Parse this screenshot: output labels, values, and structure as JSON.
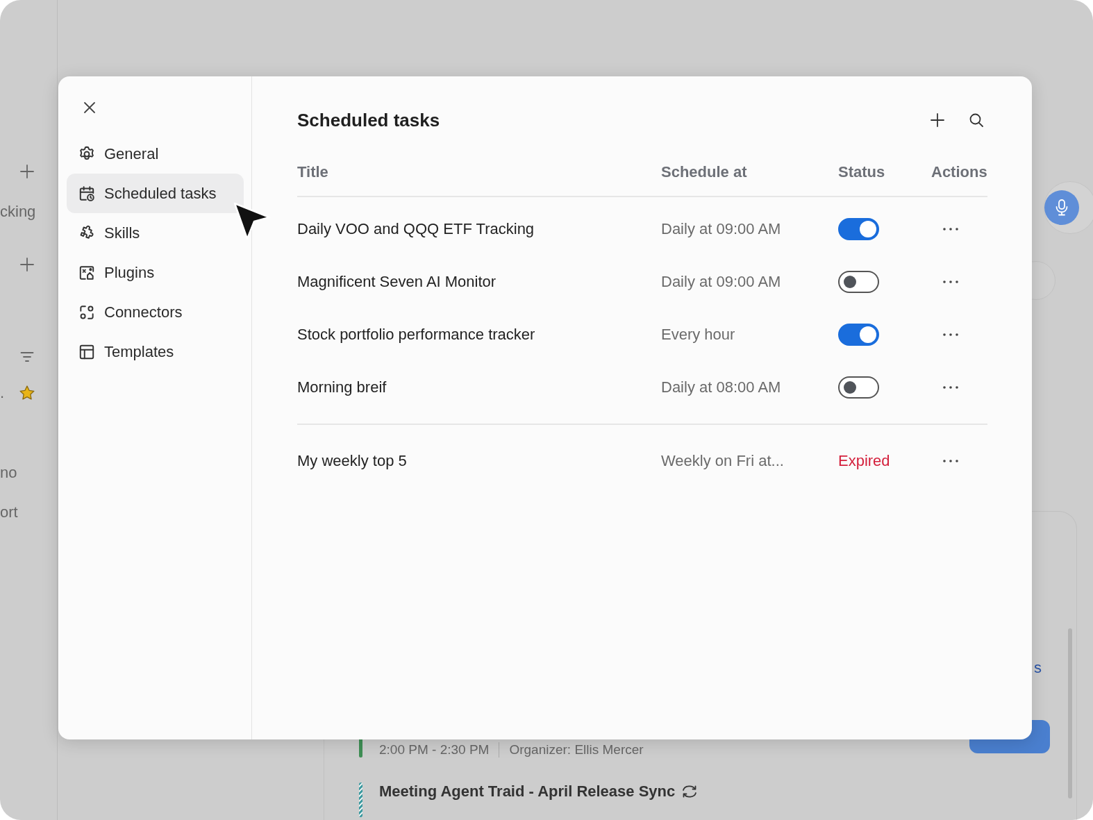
{
  "background": {
    "rail": [
      {
        "kind": "add"
      },
      {
        "kind": "text",
        "label": "cking"
      },
      {
        "kind": "add"
      },
      {
        "kind": "filter"
      },
      {
        "kind": "starred",
        "label": "."
      },
      {
        "kind": "text",
        "label": "no"
      },
      {
        "kind": "text",
        "label": "ort"
      }
    ],
    "link": "s",
    "meetings": [
      {
        "time": "2:00 PM - 2:30 PM",
        "organizer": "Organizer: Ellis Mercer",
        "color": "#3f8f55"
      },
      {
        "title": "Meeting Agent Traid - April Release Sync",
        "recurring": true,
        "color": "#3e9aa0"
      }
    ]
  },
  "settings": {
    "nav": [
      {
        "label": "General",
        "kind": "gear",
        "selected": false
      },
      {
        "label": "Scheduled tasks",
        "kind": "calendar",
        "selected": true
      },
      {
        "label": "Skills",
        "kind": "puzzle",
        "selected": false
      },
      {
        "label": "Plugins",
        "kind": "plugin",
        "selected": false
      },
      {
        "label": "Connectors",
        "kind": "connectors",
        "selected": false
      },
      {
        "label": "Templates",
        "kind": "templates",
        "selected": false
      }
    ],
    "title": "Scheduled tasks",
    "table": {
      "columns": [
        "Title",
        "Schedule at",
        "Status",
        "Actions"
      ],
      "groups": [
        {
          "rows": [
            {
              "title": "Daily VOO and QQQ ETF Tracking",
              "schedule": "Daily at 09:00 AM",
              "kind": "toggle",
              "on": true
            },
            {
              "title": "Magnificent Seven AI Monitor",
              "schedule": "Daily at 09:00 AM",
              "kind": "toggle",
              "on": false
            },
            {
              "title": "Stock portfolio performance tracker",
              "schedule": "Every hour",
              "kind": "toggle",
              "on": true
            },
            {
              "title": "Morning breif",
              "schedule": "Daily at 08:00 AM",
              "kind": "toggle",
              "on": false
            }
          ]
        },
        {
          "rows": [
            {
              "title": "My weekly top 5",
              "schedule": "Weekly on Fri at...",
              "kind": "label",
              "status": "Expired"
            }
          ]
        }
      ]
    }
  }
}
